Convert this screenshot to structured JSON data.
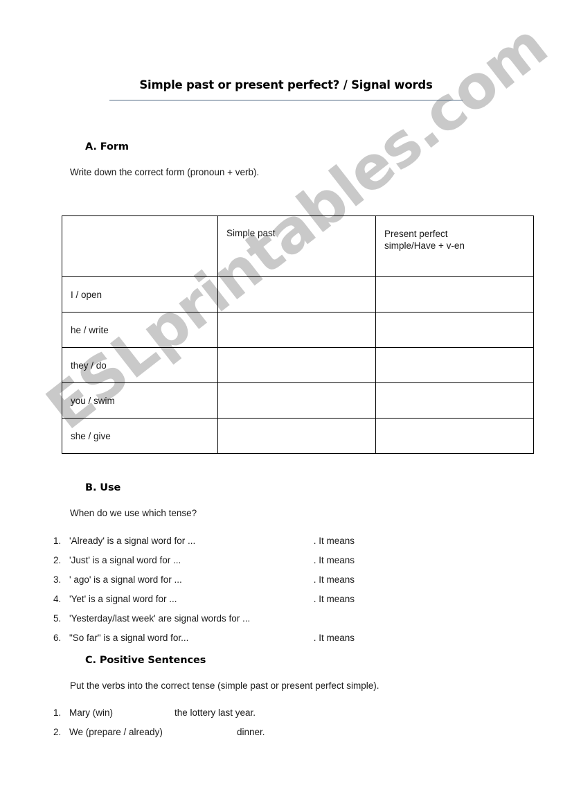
{
  "document": {
    "title": "Simple past or present perfect? / Signal words",
    "watermark": "ESLprintables.com",
    "accent_color": "#4a6580",
    "watermark_color": "#c9c9c9"
  },
  "section_a": {
    "heading": "A. Form",
    "instruction": "Write down the correct form (pronoun + verb).",
    "table": {
      "headers": [
        "",
        "Simple past",
        "Present perfect simple/Have + v-en"
      ],
      "header_col3_line1": "Present perfect",
      "header_col3_line2": "simple/Have + v-en",
      "rows": [
        {
          "label": "I / open",
          "simple_past": "",
          "present_perfect": ""
        },
        {
          "label": "he / write",
          "simple_past": "",
          "present_perfect": ""
        },
        {
          "label": "they / do",
          "simple_past": "",
          "present_perfect": ""
        },
        {
          "label": "you / swim",
          "simple_past": "",
          "present_perfect": ""
        },
        {
          "label": "she / give",
          "simple_past": "",
          "present_perfect": ""
        }
      ]
    }
  },
  "section_b": {
    "heading": "B.  Use",
    "instruction": "When do we use which tense?",
    "items": [
      {
        "number": "1.",
        "text": "'Already' is a signal word for ...",
        "tail": ". It means"
      },
      {
        "number": "2.",
        "text": "'Just' is a signal word for ...",
        "tail": ". It means"
      },
      {
        "number": "3.",
        "text": "' ago' is a signal word for ...",
        "tail": ". It means"
      },
      {
        "number": "4.",
        "text": "'Yet' is a signal word for ...",
        "tail": ". It means"
      },
      {
        "number": "5.",
        "text": "'Yesterday/last week' are signal words for ...",
        "tail": ""
      },
      {
        "number": "6.",
        "text": "\"So far\" is a signal word for...",
        "tail": ". It means"
      }
    ]
  },
  "section_c": {
    "heading": "C. Positive Sentences",
    "instruction": "Put the verbs into the correct tense (simple past or present perfect simple).",
    "items": [
      {
        "number": "1.",
        "subject_verb": "Mary (win)",
        "rest": "the lottery last year."
      },
      {
        "number": "2.",
        "subject_verb": "We (prepare / already)",
        "rest": "dinner."
      }
    ]
  }
}
